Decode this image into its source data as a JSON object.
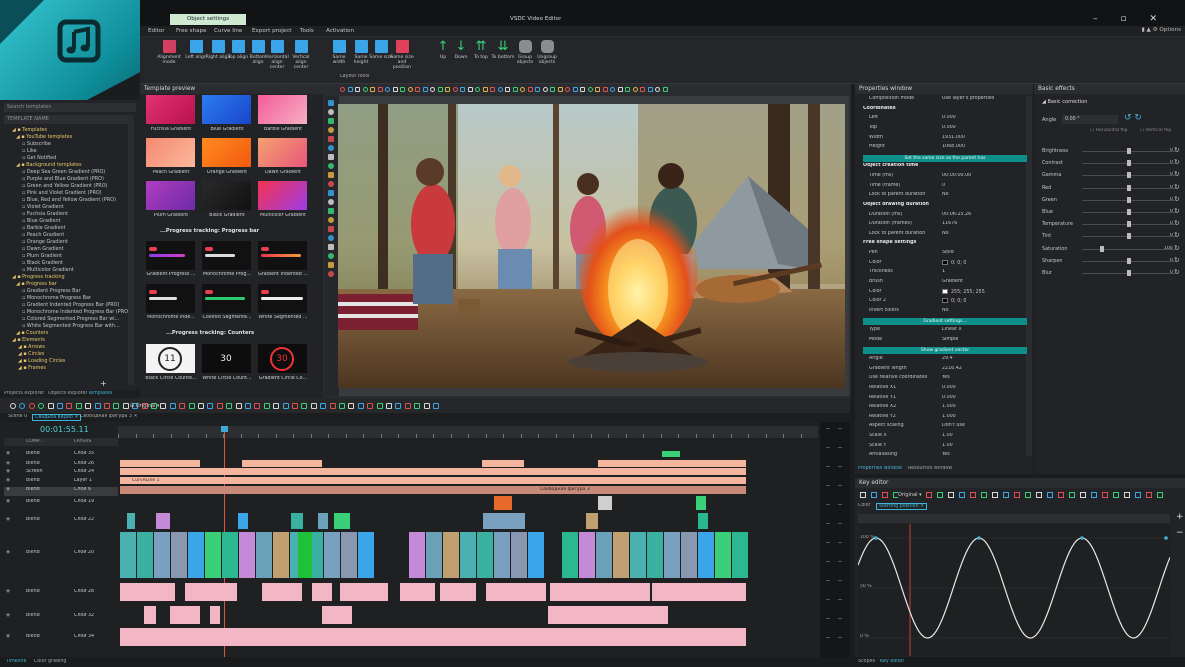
{
  "window": {
    "title": "VSDC Video Editor",
    "menu_right": "Options"
  },
  "menu": {
    "items": [
      "Editor",
      "Free shape",
      "Curve line",
      "Export project",
      "Tools",
      "Activation"
    ],
    "active_tab": "Object settings"
  },
  "ribbon": {
    "buttons": [
      "Alignment mode",
      "Left align",
      "Right align",
      "Top align",
      "Bottom align",
      "Horizontal align center",
      "Vertical align center",
      "Same width",
      "Same height",
      "Same size",
      "Same size and position",
      "Up",
      "Down",
      "To top",
      "To bottom",
      "Group objects",
      "Ungroup objects"
    ],
    "group_label": "Layout tools"
  },
  "left_panel": {
    "search_placeholder": "Search templates",
    "name_header": "TEMPLATE NAME",
    "tree": [
      "Templates",
      "YouTube templates",
      "Subscribe",
      "Like",
      "Get Notified",
      "Background templates",
      "Deep Sea Green Gradient (PRO)",
      "Purple and Blue Gradient (PRO)",
      "Green and Yellow Gradient (PRO)",
      "Pink and Violet Gradient (PRO)",
      "Blue, Red and Yellow Gradient (PRO)",
      "Violet Gradient",
      "Fuchsia Gradient",
      "Blue Gradient",
      "Barbie Gradient",
      "Peach Gradient",
      "Orange Gradient",
      "Dawn Gradient",
      "Plum Gradient",
      "Black Gradient",
      "Multicolor Gradient",
      "Progress tracking",
      "Progress bar",
      "Gradient Progress Bar",
      "Monochrome Progress Bar",
      "Gradient Indented Progress Bar (PRO)",
      "Monochrome Indented Progress Bar (PRO)",
      "Colored Segmented Progress Bar wi...",
      "White Segmented Progress Bar with...",
      "Counters",
      "Elements",
      "Arrows",
      "Circles",
      "Loading Circles",
      "Frames"
    ],
    "tabs": [
      "Projects explorer",
      "Objects explorer",
      "Templates"
    ]
  },
  "template_preview": {
    "title": "Template preview",
    "gradients": [
      {
        "label": "Fuchsia Gradient",
        "c1": "#e2336f",
        "c2": "#b7124f"
      },
      {
        "label": "Blue Gradient",
        "c1": "#2d7bf0",
        "c2": "#1846c9"
      },
      {
        "label": "Barbie Gradient",
        "c1": "#f45b9a",
        "c2": "#f7b0c2"
      },
      {
        "label": "Peach Gradient",
        "c1": "#f48a72",
        "c2": "#fbb79a"
      },
      {
        "label": "Orange Gradient",
        "c1": "#ff8a1e",
        "c2": "#f25a0f"
      },
      {
        "label": "Dawn Gradient",
        "c1": "#f4a16f",
        "c2": "#e9567a"
      },
      {
        "label": "Plum Gradient",
        "c1": "#b03dc0",
        "c2": "#6d2ba8"
      },
      {
        "label": "Black Gradient",
        "c1": "#2a2a2a",
        "c2": "#111111"
      },
      {
        "label": "Multicolor Gradient",
        "c1": "#f5334f",
        "c2": "#9c3ce7"
      }
    ],
    "section_progress": "...Progress tracking: Progress bar",
    "progress": [
      "Gradient Progress ...",
      "Monochrome Prog...",
      "Gradient Indented ...",
      "Monochrome Inde...",
      "Colored Segmente...",
      "White Segmented ..."
    ],
    "section_counters": "...Progress tracking: Counters",
    "counters": [
      {
        "label": "Black Circle Counte...",
        "value": "11"
      },
      {
        "label": "White Circle Count...",
        "value": "30"
      },
      {
        "label": "Gradient Circle Co...",
        "value": "30"
      }
    ]
  },
  "properties": {
    "title": "Properties window",
    "rows": [
      {
        "k": "Composition mode",
        "v": "Use layer's properties",
        "type": "row"
      },
      {
        "k": "Coordinates",
        "v": "",
        "type": "sect"
      },
      {
        "k": "Left",
        "v": "0.000",
        "type": "row"
      },
      {
        "k": "Top",
        "v": "0.000",
        "type": "row"
      },
      {
        "k": "Width",
        "v": "1931.000",
        "type": "row"
      },
      {
        "k": "Height",
        "v": "1068.000",
        "type": "row"
      },
      {
        "k": "Set the same size as the parent has",
        "v": "",
        "type": "btn"
      },
      {
        "k": "Object creation time",
        "v": "",
        "type": "sect"
      },
      {
        "k": "Time (ms)",
        "v": "00:00:00.00",
        "type": "row"
      },
      {
        "k": "Time (frame)",
        "v": "0",
        "type": "row"
      },
      {
        "k": "Lock to parent duration",
        "v": "No",
        "type": "row"
      },
      {
        "k": "Object drawing duration",
        "v": "",
        "type": "sect"
      },
      {
        "k": "Duration (ms)",
        "v": "00:06:25.26",
        "type": "row"
      },
      {
        "k": "Duration (frames)",
        "v": "11676",
        "type": "row"
      },
      {
        "k": "Lock to parent duration",
        "v": "No",
        "type": "row"
      },
      {
        "k": "Free shape settings",
        "v": "",
        "type": "sect"
      },
      {
        "k": "Pen",
        "v": "Solid",
        "type": "row"
      },
      {
        "k": "Color",
        "v": "0; 0; 0",
        "type": "row"
      },
      {
        "k": "Thickness",
        "v": "1",
        "type": "row"
      },
      {
        "k": "Brush",
        "v": "Gradient",
        "type": "row"
      },
      {
        "k": "Color",
        "v": "255; 255; 255",
        "type": "row"
      },
      {
        "k": "Color 2",
        "v": "0; 0; 0",
        "type": "row"
      },
      {
        "k": "Invert colors",
        "v": "No",
        "type": "row"
      },
      {
        "k": "Gradient settings...",
        "v": "",
        "type": "btn"
      },
      {
        "k": "Type",
        "v": "Linear X",
        "type": "row"
      },
      {
        "k": "Mode",
        "v": "Simple",
        "type": "row"
      },
      {
        "k": "Show gradient vector",
        "v": "",
        "type": "btn"
      },
      {
        "k": "Angle",
        "v": "29.4",
        "type": "row"
      },
      {
        "k": "Gradient length",
        "v": "2216.42",
        "type": "row"
      },
      {
        "k": "Use relative coordinates",
        "v": "Yes",
        "type": "row"
      },
      {
        "k": "Relative X1",
        "v": "0.000",
        "type": "row"
      },
      {
        "k": "Relative Y1",
        "v": "0.000",
        "type": "row"
      },
      {
        "k": "Relative X2",
        "v": "1.000",
        "type": "row"
      },
      {
        "k": "Relative Y2",
        "v": "1.000",
        "type": "row"
      },
      {
        "k": "Aspect scaling",
        "v": "Don't use",
        "type": "row"
      },
      {
        "k": "Scale X",
        "v": "1.00",
        "type": "row"
      },
      {
        "k": "Scale Y",
        "v": "1.00",
        "type": "row"
      },
      {
        "k": "Antialiasing",
        "v": "Yes",
        "type": "row"
      }
    ],
    "tabs": [
      "Properties window",
      "Resources window"
    ]
  },
  "effects": {
    "title": "Basic effects",
    "group": "Basic correction",
    "angle_label": "Angle",
    "angle_value": "0.00 °",
    "flip_h": "Horizontal flip",
    "flip_v": "Vertical flip",
    "sliders": [
      {
        "k": "Brightness",
        "v": "0",
        "pos": 0.5
      },
      {
        "k": "Contrast",
        "v": "0",
        "pos": 0.5
      },
      {
        "k": "Gamma",
        "v": "0",
        "pos": 0.5
      },
      {
        "k": "Red",
        "v": "0",
        "pos": 0.5
      },
      {
        "k": "Green",
        "v": "0",
        "pos": 0.5
      },
      {
        "k": "Blue",
        "v": "0",
        "pos": 0.5
      },
      {
        "k": "Temperature",
        "v": "0",
        "pos": 0.5
      },
      {
        "k": "Tint",
        "v": "0",
        "pos": 0.5
      },
      {
        "k": "Saturation",
        "v": "100",
        "pos": 0.2
      },
      {
        "k": "Sharpen",
        "v": "0",
        "pos": 0.5
      },
      {
        "k": "Blur",
        "v": "0",
        "pos": 0.5
      }
    ]
  },
  "timeline": {
    "time": "00:01:55.11",
    "zoom": "Original",
    "tabs": [
      "Scene 0",
      "Свадьба видео",
      "Свободная фигура 3"
    ],
    "header": [
      "COMP...",
      "LAYERS"
    ],
    "layers": [
      {
        "blend": "Blend",
        "name": "Слой 35"
      },
      {
        "blend": "Blend",
        "name": "Слой 26"
      },
      {
        "blend": "Screen",
        "name": "Слой 24"
      },
      {
        "blend": "Blend",
        "name": "Layer 1"
      },
      {
        "blend": "Blend",
        "name": "Слой 6"
      },
      {
        "blend": "Blend",
        "name": "Слой 19"
      },
      {
        "blend": "Blend",
        "name": "Слой 22"
      },
      {
        "blend": "Blend",
        "name": "Слой 20"
      },
      {
        "blend": "Blend",
        "name": "Слой 28"
      },
      {
        "blend": "Blend",
        "name": "Слой 32"
      },
      {
        "blend": "Blend",
        "name": "Слой 34"
      }
    ],
    "clip_labels": {
      "curve": "CurveLine 1",
      "shape": "Свободная фигура 3"
    }
  },
  "key_editor": {
    "title": "Key editor",
    "zoom": "Original",
    "tabs": [
      "Color",
      "Starting position"
    ],
    "y_labels": [
      "100 %",
      "50 %",
      "0 %"
    ]
  },
  "status": {
    "left": [
      "Timeline",
      "Color grading"
    ],
    "right": [
      "Scopes",
      "Key editor"
    ]
  }
}
